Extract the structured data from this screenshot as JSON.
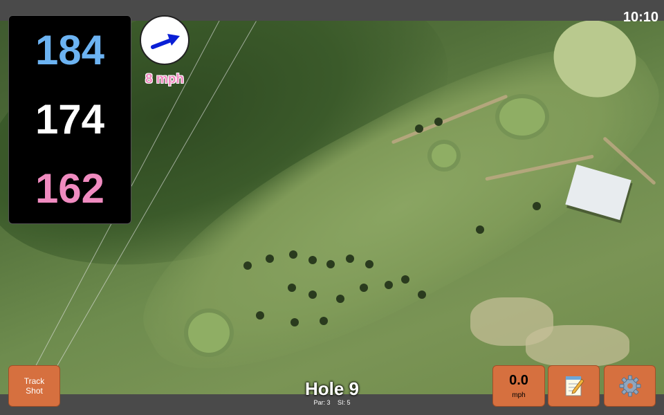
{
  "clock": "10:10",
  "distances": {
    "back": "184",
    "middle": "174",
    "front": "162"
  },
  "wind": {
    "speed_label": "8 mph",
    "icon": "wind-direction-arrow"
  },
  "buttons": {
    "track_shot": {
      "line1": "Track",
      "line2": "Shot"
    },
    "speed": {
      "value": "0.0",
      "unit": "mph"
    },
    "notes_icon": "notepad-icon",
    "settings_icon": "gear-icon"
  },
  "hole": {
    "title": "Hole 9",
    "par": "Par: 3",
    "si": "SI: 5"
  },
  "colors": {
    "back": "#6cb3f2",
    "middle": "#ffffff",
    "front": "#f08bc0",
    "button": "#d6703f",
    "wind_arrow": "#0a1fd6"
  }
}
